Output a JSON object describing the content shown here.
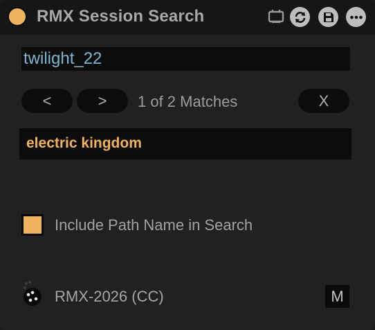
{
  "window": {
    "title": "RMX Session Search",
    "toolbar": {
      "icons": [
        "status-dot-icon",
        "tv-icon",
        "refresh-icon",
        "save-icon",
        "more-icon"
      ]
    }
  },
  "search": {
    "value": "twilight_22"
  },
  "navigation": {
    "prev_label": "<",
    "next_label": ">",
    "match_status": "1 of 2 Matches",
    "clear_label": "X"
  },
  "result": {
    "value": "electric kingdom"
  },
  "options": {
    "include_path_label": "Include Path Name in Search",
    "include_path_checked": true
  },
  "device": {
    "icon": "midi-device-icon",
    "label": "RMX-2026 (CC)",
    "mode_button_label": "M"
  },
  "colors": {
    "accent": "#f0b35e",
    "search_text": "#7fb5cf",
    "result_text": "#f2b263",
    "background": "#212121",
    "titlebar": "#161616"
  }
}
